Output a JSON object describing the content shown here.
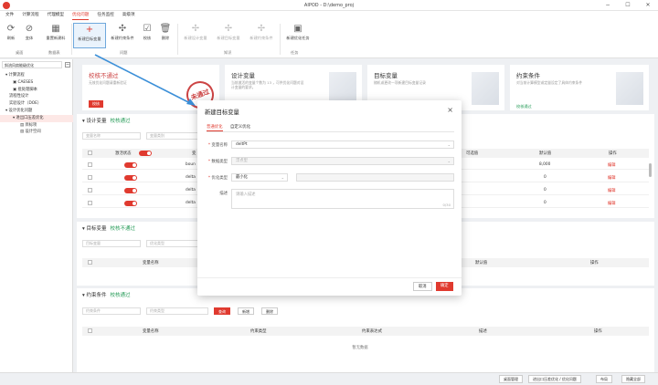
{
  "window": {
    "title": "AIPOD - D:\\demo_proj",
    "minimize": "−",
    "maximize": "☐",
    "close": "✕"
  },
  "menu": [
    "文件",
    "计算流程",
    "代理模型",
    "优化问题",
    "任务监控",
    "高级项"
  ],
  "toolbar": {
    "buttons": [
      {
        "label": "刷新",
        "icon": "refresh-icon"
      },
      {
        "label": "变体",
        "icon": "variant-icon"
      },
      {
        "label": "重置新建料",
        "icon": "reset-icon"
      },
      {
        "label": "新建目标变量",
        "icon": "plus-icon"
      },
      {
        "label": "新建约束条件",
        "icon": "constraint-icon"
      },
      {
        "label": "校核",
        "icon": "check-icon"
      },
      {
        "label": "删除",
        "icon": "delete-icon"
      },
      {
        "label": "新建设计变量",
        "icon": "design-var-icon"
      },
      {
        "label": "新建目标变量",
        "icon": "target-var-icon"
      },
      {
        "label": "新建约束条件",
        "icon": "constraint2-icon"
      },
      {
        "label": "新建优化任务",
        "icon": "task-icon"
      }
    ],
    "groups": [
      "桌面",
      "数据表",
      "问题",
      "知识",
      "任务"
    ]
  },
  "sidebar": {
    "header": "斜流风扇能级优化",
    "tree": [
      "计算流程",
      "CAESES",
      "批处理脚本",
      "流程性设计",
      "实验设计（DOE）",
      "设计优化问题",
      "进出口压差优化",
      "目标项",
      "设计空间"
    ]
  },
  "cards": [
    {
      "title": "校核不通过",
      "subtitle": "无效优化问题请重新验证",
      "button": "校核"
    },
    {
      "title": "设计变量",
      "subtitle": "当前激活的变量个数为 13 ，可供优化问题对设计变量的要求。"
    },
    {
      "title": "目标变量",
      "subtitle": "随机或更改一项新建目标变量记录"
    },
    {
      "title": "约束条件",
      "subtitle": "对当前计算模型或定量设定了具体约束条件",
      "link": "校核通过"
    }
  ],
  "stamp": "未通过",
  "design_section": {
    "title": "设计变量",
    "status": "校核通过",
    "search1": "变量名称",
    "search2": "变量类别",
    "columns": [
      "激活状态",
      "变",
      "可选值",
      "默认值",
      "操作"
    ],
    "rows": [
      {
        "name": "boun",
        "default": "8,000",
        "op": "编辑"
      },
      {
        "name": "delta",
        "default": "0",
        "op": "编辑"
      },
      {
        "name": "delta",
        "default": "0",
        "op": "编辑"
      },
      {
        "name": "delta",
        "default": "0",
        "op": "编辑"
      }
    ]
  },
  "target_section": {
    "title": "目标变量",
    "status": "校核不通过",
    "search1": "目标变量",
    "search2": "优化类型",
    "columns": [
      "变量名称",
      "默认值",
      "操作"
    ]
  },
  "constraint_section": {
    "title": "约束条件",
    "status": "校核通过",
    "search1": "约束条件",
    "search2": "约束类型",
    "btn_search": "查询",
    "btn_add": "新增",
    "btn_delete": "删除",
    "columns": [
      "变量名称",
      "约束类型",
      "约束表达式",
      "描述",
      "操作"
    ],
    "empty": "暂无数据"
  },
  "dialog": {
    "title": "新建目标变量",
    "tabs": [
      "普通优化",
      "自定义优化"
    ],
    "fields": {
      "name_label": "变量名称",
      "name_value": "deltPt",
      "type_label": "数据类型",
      "type_value": "浮点型",
      "opt_label": "优化类型",
      "opt_value": "最小化",
      "desc_label": "描述",
      "desc_placeholder": "请输入描述",
      "desc_count": "0/30"
    },
    "cancel": "取消",
    "confirm": "确定"
  },
  "statusbar": {
    "b1": "桌面管理",
    "b2": "进出口压差优化 / 优化问题",
    "b3": "布局",
    "b4": "隐藏全部"
  }
}
